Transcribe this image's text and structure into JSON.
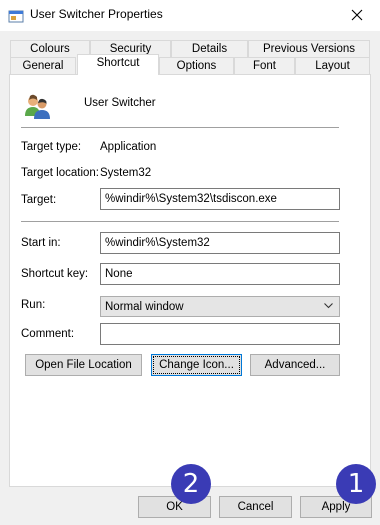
{
  "window": {
    "title": "User Switcher Properties",
    "icon": "window-app-icon",
    "close_icon": "close-icon"
  },
  "tabs": {
    "row1": [
      {
        "label": "Colours"
      },
      {
        "label": "Security"
      },
      {
        "label": "Details"
      },
      {
        "label": "Previous Versions"
      }
    ],
    "row2": [
      {
        "label": "General"
      },
      {
        "label": "Shortcut",
        "active": true
      },
      {
        "label": "Options"
      },
      {
        "label": "Font"
      },
      {
        "label": "Layout"
      }
    ]
  },
  "shortcut": {
    "app_name": "User Switcher",
    "target_type_label": "Target type:",
    "target_type_value": "Application",
    "target_location_label": "Target location:",
    "target_location_value": "System32",
    "target_label": "Target:",
    "target_value": "%windir%\\System32\\tsdiscon.exe",
    "start_in_label": "Start in:",
    "start_in_value": "%windir%\\System32",
    "shortcut_key_label": "Shortcut key:",
    "shortcut_key_value": "None",
    "run_label": "Run:",
    "run_value": "Normal window",
    "comment_label": "Comment:",
    "comment_value": "",
    "open_file_location": "Open File Location",
    "change_icon": "Change Icon...",
    "advanced": "Advanced..."
  },
  "footer": {
    "ok": "OK",
    "cancel": "Cancel",
    "apply": "Apply"
  },
  "annotations": {
    "badge_1": "1",
    "badge_2": "2",
    "badge_color": "#3a3bb5"
  }
}
